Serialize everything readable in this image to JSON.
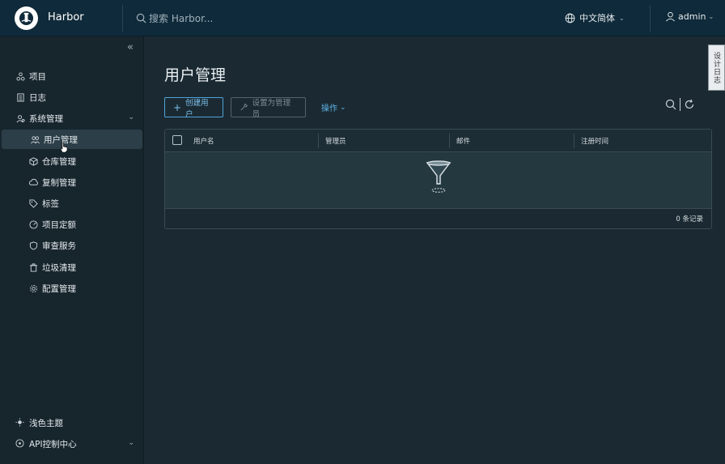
{
  "header": {
    "brand": "Harbor",
    "search_placeholder": "搜索 Harbor...",
    "language": "中文简体",
    "user": "admin"
  },
  "sidebar": {
    "items": [
      {
        "label": "项目",
        "icon": "projects-icon"
      },
      {
        "label": "日志",
        "icon": "logs-icon"
      },
      {
        "label": "系统管理",
        "icon": "admin-icon",
        "expanded": true
      },
      {
        "label": "用户管理",
        "icon": "users-icon",
        "active": true
      },
      {
        "label": "仓库管理",
        "icon": "registry-icon"
      },
      {
        "label": "复制管理",
        "icon": "replication-icon"
      },
      {
        "label": "标签",
        "icon": "tag-icon"
      },
      {
        "label": "项目定额",
        "icon": "quota-icon"
      },
      {
        "label": "审查服务",
        "icon": "shield-icon"
      },
      {
        "label": "垃圾清理",
        "icon": "trash-icon"
      },
      {
        "label": "配置管理",
        "icon": "gear-icon"
      }
    ],
    "bottom": [
      {
        "label": "浅色主题",
        "icon": "sun-icon"
      },
      {
        "label": "API控制中心",
        "icon": "api-icon"
      }
    ]
  },
  "feedback_tab": "设计日志",
  "main": {
    "title": "用户管理",
    "create_button": "创建用户",
    "set_admin_button": "设置为管理员",
    "operations": "操作",
    "columns": [
      "用户名",
      "管理员",
      "邮件",
      "注册时间"
    ],
    "rows": [],
    "footer": "0 条记录"
  },
  "colors": {
    "header_bg": "#0f2a3a",
    "sidebar_bg": "#17252d",
    "main_bg": "#1b2a32",
    "accent": "#4fa3d9"
  }
}
